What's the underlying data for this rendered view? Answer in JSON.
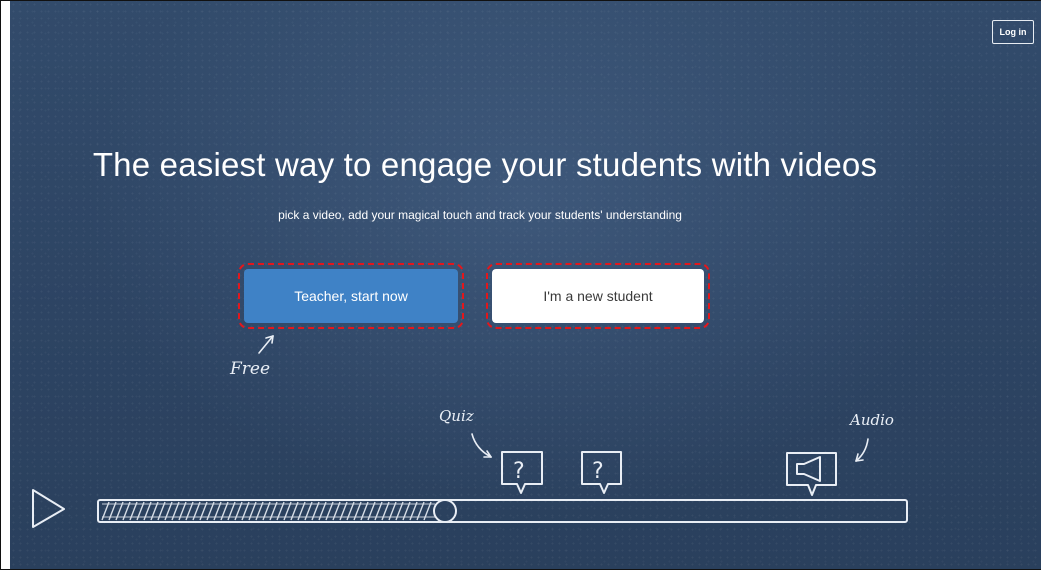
{
  "header": {
    "login_label": "Log in"
  },
  "hero": {
    "headline": "The easiest way to engage your students with videos",
    "subline": "pick a video, add your magical touch and track your students' understanding"
  },
  "actions": {
    "teacher_label": "Teacher, start now",
    "student_label": "I'm a new student"
  },
  "illustration": {
    "free_label": "Free",
    "quiz_label": "Quiz",
    "audio_label": "Audio",
    "quiz_marker_glyph": "?",
    "icons": [
      "play-icon",
      "quiz-marker-icon",
      "audio-marker-icon"
    ]
  },
  "colors": {
    "board_background": "#2d4463",
    "teacher_button": "#3f82c6",
    "student_button": "#ffffff",
    "highlight_border": "#e3171c"
  }
}
